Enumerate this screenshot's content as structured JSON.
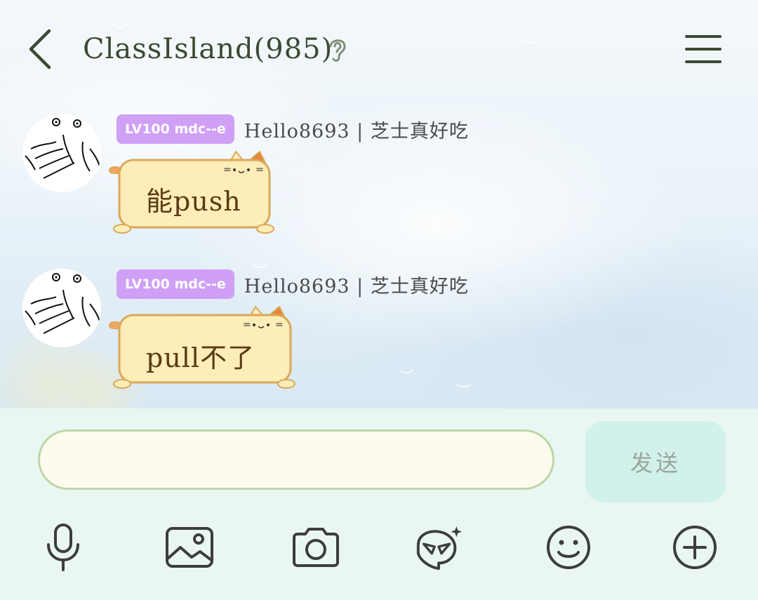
{
  "header": {
    "title": "ClassIsland(985)",
    "icons": [
      "back-arrow-icon",
      "ear-icon",
      "menu-icon"
    ]
  },
  "messages": [
    {
      "level_badge": "LV100 mdc--e",
      "sender": "Hello8693 | 芝士真好吃",
      "text": "能push"
    },
    {
      "level_badge": "LV100 mdc--e",
      "sender": "Hello8693 | 芝士真好吃",
      "text": "pull不了"
    }
  ],
  "input": {
    "value": "",
    "placeholder": "",
    "send_label": "发送"
  },
  "toolbar": {
    "icons": [
      "microphone-icon",
      "image-icon",
      "camera-icon",
      "sticker-icon",
      "emoji-icon",
      "plus-icon"
    ]
  },
  "colors": {
    "badge": "#cfa0f5",
    "bubble_fill": "#fdedb8",
    "bubble_stroke": "#d9a85a",
    "send_button": "#d2f1ea",
    "input_border": "#bcd6a8",
    "title": "#3b4a33"
  }
}
